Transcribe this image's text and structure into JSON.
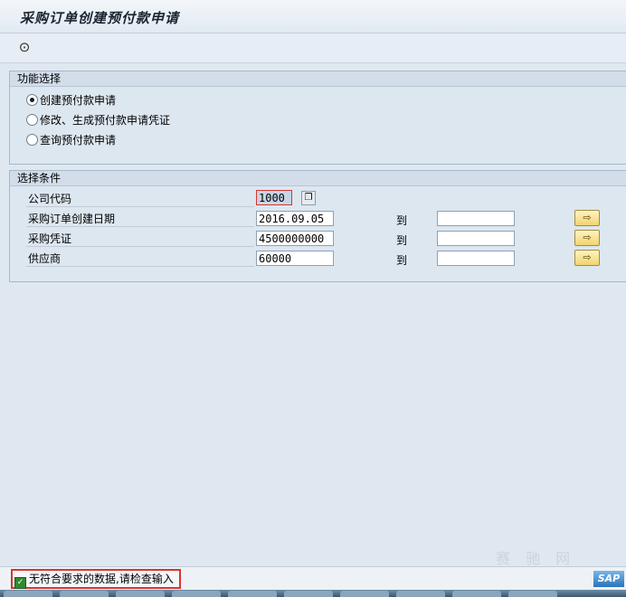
{
  "window": {
    "title": "采购订单创建预付款申请"
  },
  "toolbar": {
    "execute_icon": "execute-icon"
  },
  "function_group": {
    "header": "功能选择",
    "options": [
      {
        "label": "创建预付款申请",
        "selected": true
      },
      {
        "label": "修改、生成预付款申请凭证",
        "selected": false
      },
      {
        "label": "查询预付款申请",
        "selected": false
      }
    ]
  },
  "selection_group": {
    "header": "选择条件",
    "to_label": "到",
    "fields": [
      {
        "label": "公司代码",
        "value": "1000"
      },
      {
        "label": "采购订单创建日期",
        "value": "2016.09.05",
        "to_value": ""
      },
      {
        "label": "采购凭证",
        "value": "4500000000",
        "to_value": ""
      },
      {
        "label": "供应商",
        "value": "60000",
        "to_value": ""
      }
    ]
  },
  "statusbar": {
    "message": "无符合要求的数据,请检查输入",
    "logo": "SAP"
  },
  "watermark": "赛 驰 网",
  "colors": {
    "background": "#dfe8f1",
    "highlight": "#d8362f",
    "button_yellow": "#f1d46e"
  }
}
